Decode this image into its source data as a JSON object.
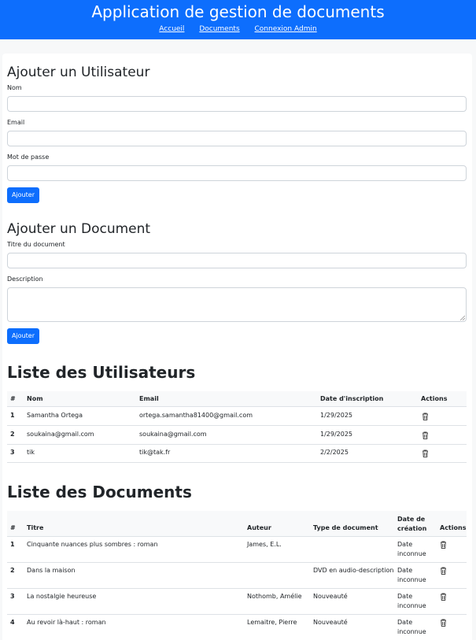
{
  "app": {
    "title": "Application de gestion de documents",
    "nav": [
      "Accueil",
      "Documents",
      "Connexion Admin"
    ]
  },
  "add_user": {
    "title": "Ajouter un Utilisateur",
    "fields": [
      "Nom",
      "Email",
      "Mot de passe"
    ],
    "button": "Ajouter"
  },
  "add_document": {
    "title": "Ajouter un Document",
    "fields": [
      "Titre du document",
      "Description"
    ],
    "button": "Ajouter"
  },
  "users": {
    "title": "Liste des Utilisateurs",
    "columns": [
      "#",
      "Nom",
      "Email",
      "Date d'inscription",
      "Actions"
    ],
    "rows": [
      {
        "id": "1",
        "name": "Samantha Ortega",
        "email": "ortega.samantha81400@gmail.com",
        "date": "1/29/2025"
      },
      {
        "id": "2",
        "name": "soukaina@gmail.com",
        "email": "soukaina@gmail.com",
        "date": "1/29/2025"
      },
      {
        "id": "3",
        "name": "tik",
        "email": "tik@tak.fr",
        "date": "2/2/2025"
      }
    ]
  },
  "documents": {
    "title": "Liste des Documents",
    "columns": [
      "#",
      "Titre",
      "Auteur",
      "Type de document",
      "Date de création",
      "Actions"
    ],
    "rows": [
      {
        "id": "1",
        "title": "Cinquante nuances plus sombres : roman",
        "author": "James, E.L.",
        "type": "",
        "date": "Date inconnue"
      },
      {
        "id": "2",
        "title": "Dans la maison",
        "author": "",
        "type": "DVD en audio-description",
        "date": "Date inconnue"
      },
      {
        "id": "3",
        "title": "La nostalgie heureuse",
        "author": "Nothomb, Amélie",
        "type": "Nouveauté",
        "date": "Date inconnue"
      },
      {
        "id": "4",
        "title": "Au revoir là-haut : roman",
        "author": "Lemaitre, Pierre",
        "type": "Nouveauté",
        "date": "Date inconnue"
      }
    ]
  },
  "icons": {
    "delete": "trash-icon"
  },
  "colors": {
    "primary": "#0d6efd"
  }
}
